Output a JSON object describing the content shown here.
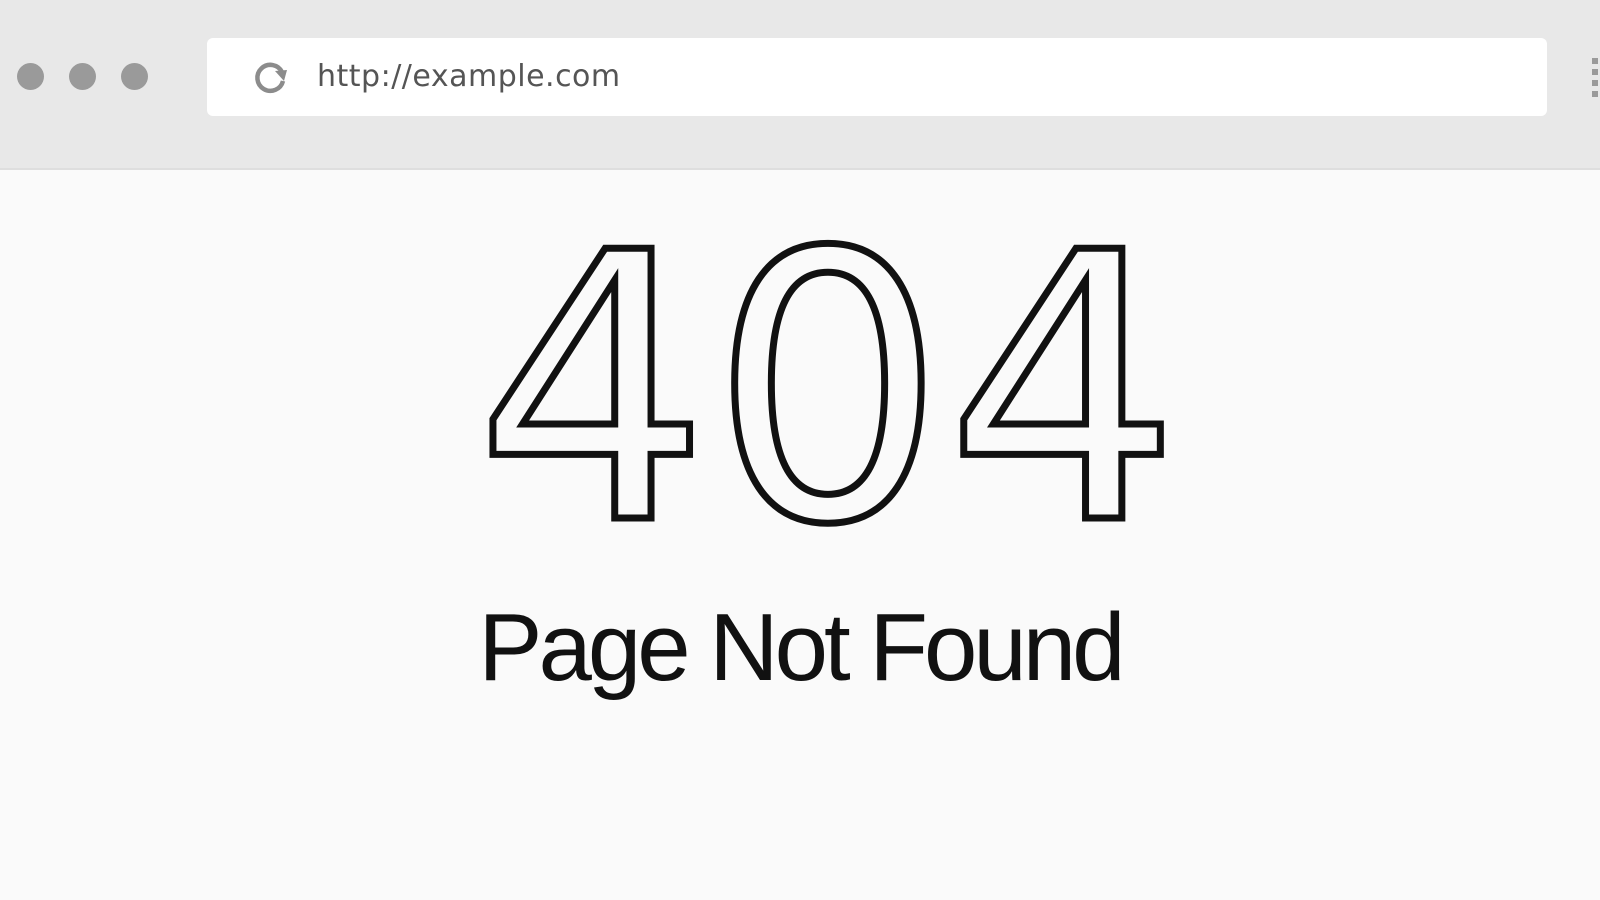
{
  "browser": {
    "url": "http://example.com",
    "icons": {
      "window_controls": [
        "window-dot-icon",
        "window-dot-icon",
        "window-dot-icon"
      ],
      "reload": "reload-icon",
      "menu": "menu-dots-icon"
    },
    "colors": {
      "chrome": "#e8e8e8",
      "controls": "#9a9a9a",
      "addressbar": "#ffffff",
      "url_text": "#555555"
    }
  },
  "page": {
    "error_code": "404",
    "message": "Page Not Found",
    "colors": {
      "background": "#fafafa",
      "text": "#111111"
    }
  }
}
